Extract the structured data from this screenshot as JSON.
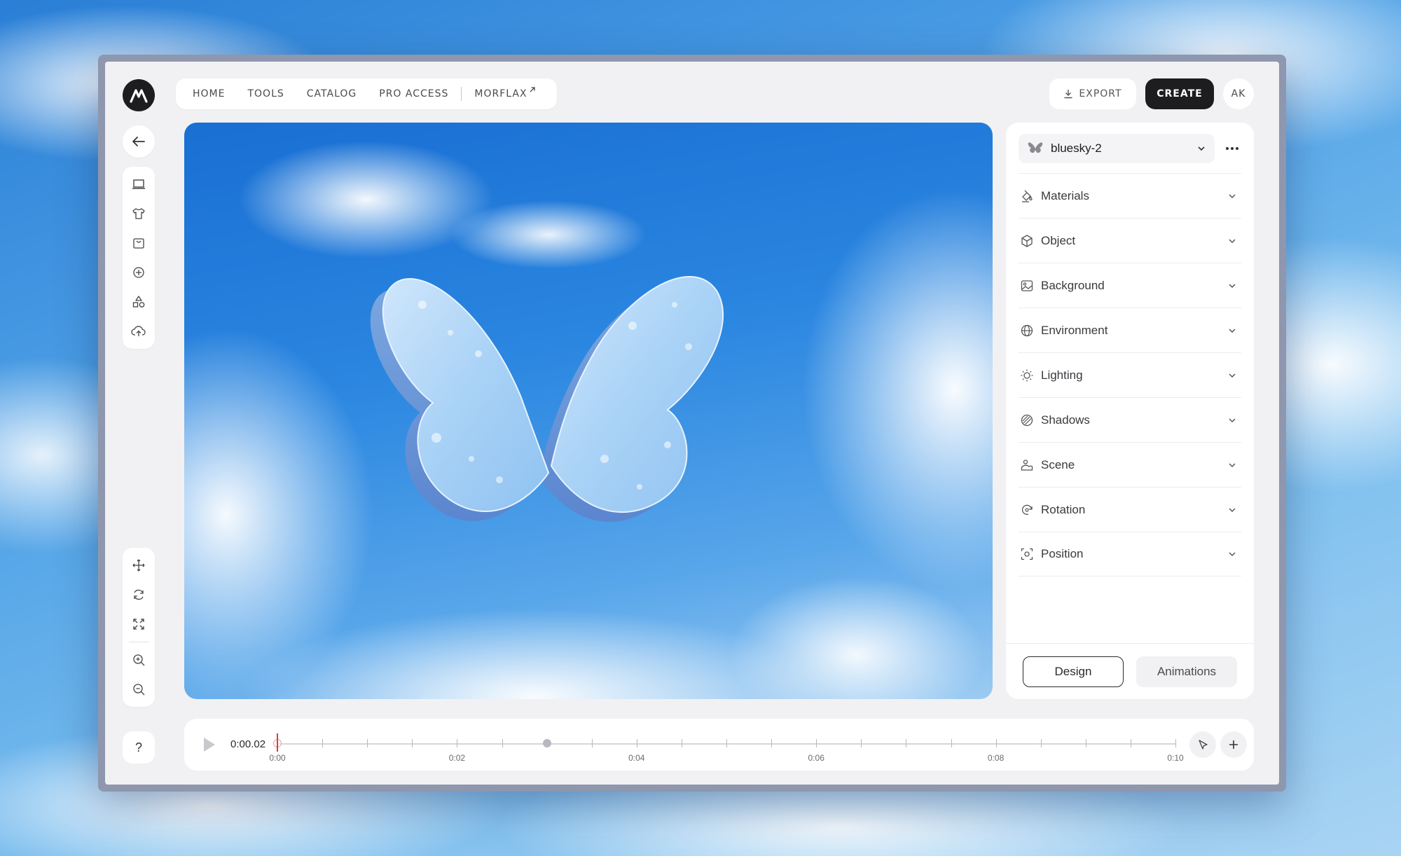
{
  "header": {
    "logo_icon": "morflax-logo-icon",
    "nav": [
      {
        "label": "HOME"
      },
      {
        "label": "TOOLS"
      },
      {
        "label": "CATALOG"
      },
      {
        "label": "PRO ACCESS"
      }
    ],
    "external_link": {
      "label": "MORFLAX",
      "icon": "arrow-up-right-icon"
    },
    "export_label": "EXPORT",
    "create_label": "CREATE",
    "avatar_initials": "AK"
  },
  "toolbar": {
    "top": [
      {
        "name": "back-arrow-icon"
      }
    ],
    "tools": [
      {
        "name": "device-icon"
      },
      {
        "name": "tshirt-icon"
      },
      {
        "name": "bag-icon"
      },
      {
        "name": "sticker-icon"
      },
      {
        "name": "shapes-icon"
      },
      {
        "name": "upload-icon"
      }
    ],
    "bottom": [
      {
        "name": "move-icon"
      },
      {
        "name": "rotate-icon"
      },
      {
        "name": "scale-icon"
      },
      {
        "name": "zoom-in-icon"
      },
      {
        "name": "zoom-out-icon"
      }
    ],
    "help_label": "?"
  },
  "panel": {
    "preset_label": "bluesky-2",
    "preset_icon": "butterfly-icon",
    "sections": [
      {
        "label": "Materials",
        "icon": "materials-icon"
      },
      {
        "label": "Object",
        "icon": "cube-icon"
      },
      {
        "label": "Background",
        "icon": "image-icon"
      },
      {
        "label": "Environment",
        "icon": "globe-icon"
      },
      {
        "label": "Lighting",
        "icon": "sun-icon"
      },
      {
        "label": "Shadows",
        "icon": "shadow-icon"
      },
      {
        "label": "Scene",
        "icon": "scene-icon"
      },
      {
        "label": "Rotation",
        "icon": "rotation-icon"
      },
      {
        "label": "Position",
        "icon": "position-icon"
      }
    ],
    "tabs": {
      "design": "Design",
      "animations": "Animations"
    },
    "active_tab": "Design"
  },
  "timeline": {
    "current_time": "0:00.02",
    "tick_labels": [
      "0:00",
      "0:02",
      "0:04",
      "0:06",
      "0:08",
      "0:10"
    ],
    "duration_seconds": 10,
    "playhead_seconds": 0,
    "keyframe_seconds": [
      3
    ],
    "accent_color": "#e03a3a"
  }
}
